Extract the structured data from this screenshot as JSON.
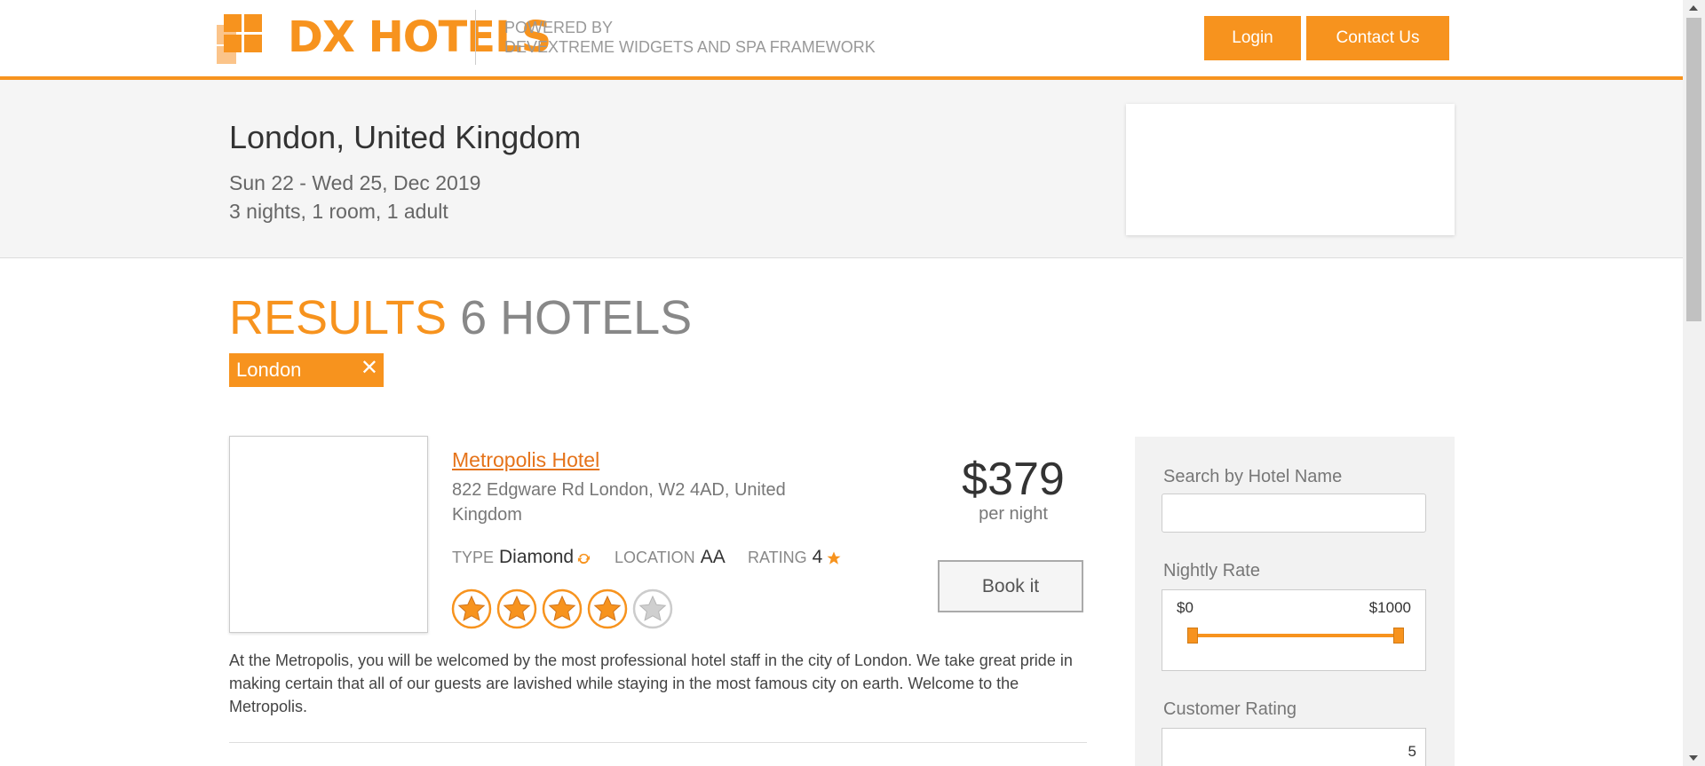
{
  "header": {
    "brand": "DX HOTELS",
    "powered_line1": "POWERED BY",
    "powered_line2": "DEVEXTREME WIDGETS AND SPA FRAMEWORK",
    "login_label": "Login",
    "contact_label": "Contact Us"
  },
  "search_summary": {
    "city": "London, United Kingdom",
    "dates": "Sun 22 - Wed 25, Dec 2019",
    "stay": "3 nights, 1 room, 1 adult"
  },
  "results": {
    "title_word": "RESULTS",
    "count_text": "6 HOTELS",
    "filter_tag": "London",
    "filter_tag_remove": "✕"
  },
  "hotel": {
    "name": "Metropolis Hotel",
    "address": "822 Edgware Rd London, W2 4AD, United Kingdom",
    "type_label": "TYPE",
    "type_value": "Diamond",
    "location_label": "LOCATION",
    "location_value": "AA",
    "rating_label": "RATING",
    "rating_value": "4",
    "stars_filled": 4,
    "stars_total": 5,
    "price": "$379",
    "per_night": "per night",
    "book_label": "Book it",
    "description": "At the Metropolis, you will be welcomed by the most professional hotel staff in the city of London. We take great pride in making certain that all of our guests are lavished while staying in the most famous city on earth. Welcome to the Metropolis."
  },
  "filters": {
    "search_label": "Search by Hotel Name",
    "search_value": "",
    "rate_label": "Nightly Rate",
    "rate_min": "$0",
    "rate_max": "$1000",
    "rating_label": "Customer Rating",
    "rating_value": "5"
  },
  "colors": {
    "accent": "#f7931e",
    "link": "#e5731a"
  }
}
